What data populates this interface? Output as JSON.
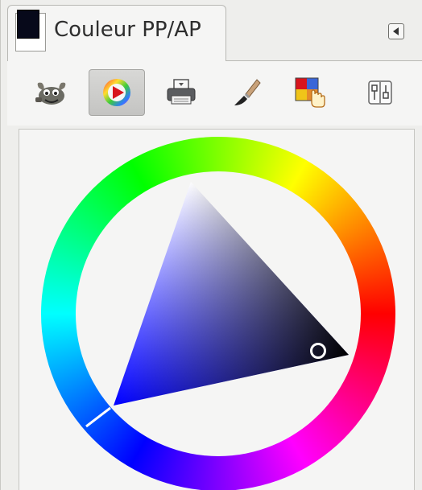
{
  "dock": {
    "tab_title": "Couleur PP/AP",
    "foreground_color": "#07091a",
    "background_color": "#ffffff"
  },
  "toolbar": {
    "tools": [
      {
        "name": "gimp-selector-icon",
        "active": false
      },
      {
        "name": "color-wheel-triangle-icon",
        "active": true
      },
      {
        "name": "scanner-printer-icon",
        "active": false
      },
      {
        "name": "paintbrush-icon",
        "active": false
      },
      {
        "name": "color-palette-pick-icon",
        "active": false
      },
      {
        "name": "scales-icon",
        "active": false
      }
    ]
  },
  "selector": {
    "type": "wheel-triangle",
    "current_hue_color": "#0000ff",
    "selected_color": "#07091a"
  }
}
